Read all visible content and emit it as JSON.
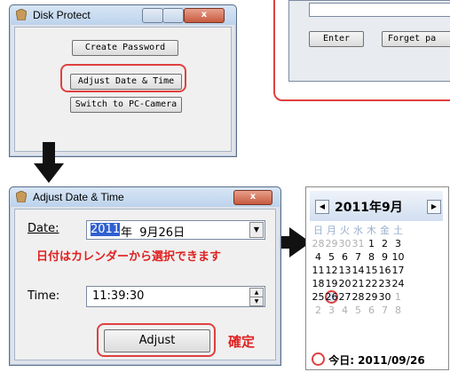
{
  "disk_protect": {
    "title": "Disk Protect",
    "buttons": {
      "create_password": "Create Password",
      "adjust_date_time": "Adjust Date & Time",
      "switch_camera": "Switch to PC-Camera"
    }
  },
  "password_dialog": {
    "enter": "Enter",
    "forget": "Forget pa"
  },
  "adjust_dialog": {
    "title": "Adjust Date & Time",
    "date_label": "Date:",
    "date_year": "2011",
    "date_rest": "年  9月26日",
    "note": "日付はカレンダーから選択できます",
    "time_label": "Time:",
    "time_value": "11:39:30",
    "adjust_button": "Adjust",
    "confirm_note": "確定"
  },
  "calendar": {
    "month_label": "2011年9月",
    "weekdays": [
      "日",
      "月",
      "火",
      "水",
      "木",
      "金",
      "土"
    ],
    "today_label": "今日: 2011/09/26"
  },
  "colors": {
    "accent_red": "#e04040",
    "select_blue": "#3060d0"
  }
}
